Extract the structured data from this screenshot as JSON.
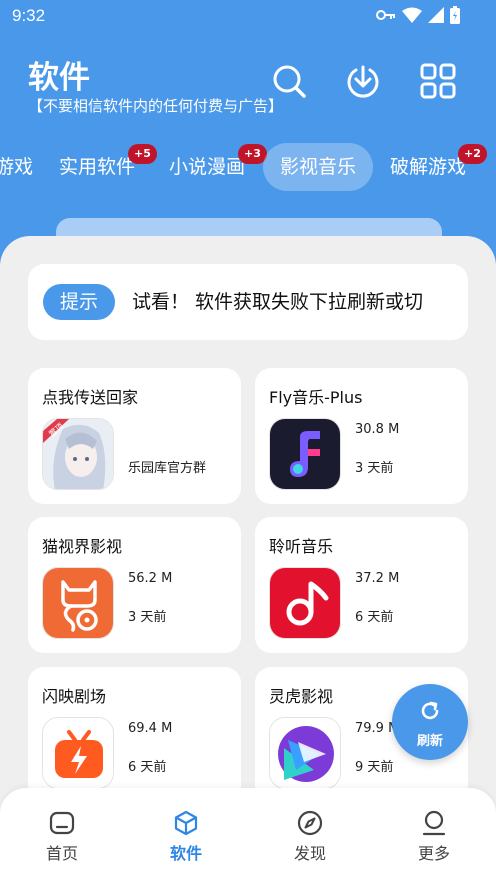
{
  "status": {
    "time": "9:32"
  },
  "header": {
    "title": "软件",
    "subtitle": "【不要相信软件内的任何付费与广告】"
  },
  "tabs": [
    {
      "label": "游戏",
      "badge": ""
    },
    {
      "label": "实用软件",
      "badge": "+5"
    },
    {
      "label": "小说漫画",
      "badge": "+3"
    },
    {
      "label": "影视音乐",
      "badge": "",
      "active": true
    },
    {
      "label": "破解游戏",
      "badge": "+2"
    }
  ],
  "notice": {
    "tag": "提示",
    "text": "试看！   软件获取失败下拉刷新或切"
  },
  "apps": [
    {
      "name": "点我传送回家",
      "note": "乐园库官方群",
      "icon": "anime-girl-icon",
      "badge": "置顶"
    },
    {
      "name": "Fly音乐-Plus",
      "size": "30.8 M",
      "date": "3 天前",
      "icon": "fly-music-icon"
    },
    {
      "name": "猫视界影视",
      "size": "56.2 M",
      "date": "3 天前",
      "icon": "cat-video-icon"
    },
    {
      "name": "聆听音乐",
      "size": "37.2 M",
      "date": "6 天前",
      "icon": "music-note-icon"
    },
    {
      "name": "闪映剧场",
      "size": "69.4 M",
      "date": "6 天前",
      "icon": "tv-flash-icon"
    },
    {
      "name": "灵虎影视",
      "size": "79.9 M",
      "date": "9 天前",
      "icon": "play-layers-icon"
    }
  ],
  "fab": {
    "label": "刷新"
  },
  "nav": [
    {
      "label": "首页",
      "icon": "home-icon"
    },
    {
      "label": "软件",
      "icon": "box-icon",
      "active": true
    },
    {
      "label": "发现",
      "icon": "compass-icon"
    },
    {
      "label": "更多",
      "icon": "person-icon"
    }
  ],
  "colors": {
    "primary": "#4a98ea",
    "badge": "#c0142a",
    "panel": "#efefef"
  }
}
